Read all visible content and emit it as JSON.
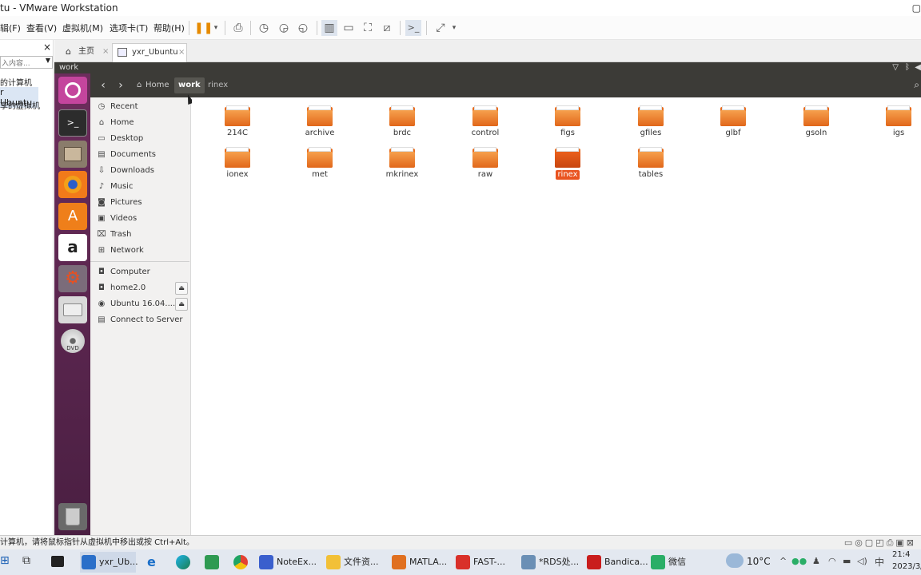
{
  "window": {
    "title": "tu - VMware Workstation"
  },
  "menubar": {
    "items": [
      "辑(F)",
      "查看(V)",
      "虚拟机(M)",
      "选项卡(T)",
      "帮助(H)"
    ]
  },
  "library": {
    "search_placeholder": "入内容...",
    "close": "×",
    "items": [
      "的计算机",
      "r Ubuntu",
      "享的虚拟机"
    ]
  },
  "tabs": [
    {
      "label": "主页",
      "close": "×"
    },
    {
      "label": "yxr_Ubuntu",
      "close": "×"
    }
  ],
  "vm": {
    "window_title": "work"
  },
  "pathbar": {
    "back": "‹",
    "forward": "›",
    "crumbs": [
      "Home",
      "work",
      "rinex"
    ]
  },
  "places": {
    "items": [
      {
        "label": "Recent",
        "icon": "clock-icon"
      },
      {
        "label": "Home",
        "icon": "home-icon"
      },
      {
        "label": "Desktop",
        "icon": "desktop-icon"
      },
      {
        "label": "Documents",
        "icon": "document-icon"
      },
      {
        "label": "Downloads",
        "icon": "download-icon"
      },
      {
        "label": "Music",
        "icon": "music-icon"
      },
      {
        "label": "Pictures",
        "icon": "camera-icon"
      },
      {
        "label": "Videos",
        "icon": "video-icon"
      },
      {
        "label": "Trash",
        "icon": "trash-icon"
      },
      {
        "label": "Network",
        "icon": "network-icon"
      }
    ],
    "devices": [
      {
        "label": "Computer",
        "icon": "drive-icon"
      },
      {
        "label": "home2.0",
        "icon": "drive-icon",
        "eject": "⏏"
      },
      {
        "label": "Ubuntu 16.04....",
        "icon": "disc-icon",
        "eject": "⏏"
      },
      {
        "label": "Connect to Server",
        "icon": "server-icon"
      }
    ]
  },
  "folders": [
    {
      "name": "214C"
    },
    {
      "name": "archive"
    },
    {
      "name": "brdc"
    },
    {
      "name": "control"
    },
    {
      "name": "figs"
    },
    {
      "name": "gfiles"
    },
    {
      "name": "glbf"
    },
    {
      "name": "gsoln"
    },
    {
      "name": "igs"
    },
    {
      "name": "ionex"
    },
    {
      "name": "met"
    },
    {
      "name": "mkrinex"
    },
    {
      "name": "raw"
    },
    {
      "name": "rinex",
      "selected": true
    },
    {
      "name": "tables"
    }
  ],
  "statusbar": {
    "text": "计算机，请将鼠标指针从虚拟机中移出或按 Ctrl+Alt。"
  },
  "taskbar": {
    "items": [
      {
        "label": "yxr_Ub...",
        "color": "#2a6fc9"
      },
      {
        "label": "NoteEx...",
        "color": "#3a5fcd"
      },
      {
        "label": "文件资...",
        "color": "#f2c037"
      },
      {
        "label": "MATLA...",
        "color": "#e07020"
      },
      {
        "label": "FAST-...",
        "color": "#d9302a"
      },
      {
        "label": "*RDS处...",
        "color": "#6a8fb5"
      },
      {
        "label": "Bandica...",
        "color": "#c91d1d"
      },
      {
        "label": "微信",
        "color": "#2aae67"
      }
    ],
    "weather": "10°C",
    "ime": "中",
    "time": "21:4",
    "date": "2023/3/"
  }
}
